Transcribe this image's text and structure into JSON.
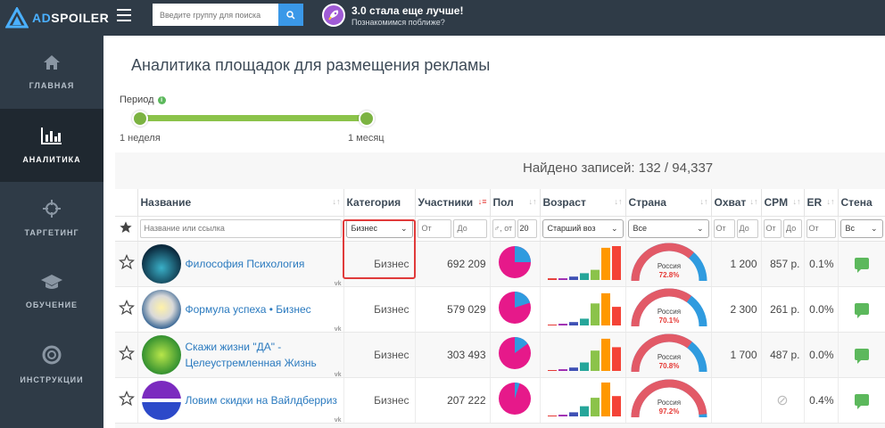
{
  "app": {
    "logo_ad": "AD",
    "logo_spoiler": "SPOILER"
  },
  "search": {
    "placeholder": "Введите группу для поиска"
  },
  "promo": {
    "title": "3.0 стала еще лучше!",
    "subtitle": "Познакомимся поближе?"
  },
  "sidebar": {
    "items": [
      {
        "label": "ГЛАВНАЯ",
        "icon": "home-icon"
      },
      {
        "label": "АНАЛИТИКА",
        "icon": "bar-chart-icon"
      },
      {
        "label": "ТАРГЕТИНГ",
        "icon": "target-icon"
      },
      {
        "label": "ОБУЧЕНИЕ",
        "icon": "graduation-cap-icon"
      },
      {
        "label": "ИНСТРУКЦИИ",
        "icon": "lifebuoy-icon"
      }
    ]
  },
  "page": {
    "title": "Аналитика площадок для размещения рекламы"
  },
  "period": {
    "label": "Период",
    "min_label": "1 неделя",
    "max_label": "1 месяц"
  },
  "results": {
    "label": "Найдено записей:",
    "count": "132 / 94,337"
  },
  "columns": {
    "name": "Название",
    "category": "Категория",
    "members": "Участники",
    "sex": "Пол",
    "age": "Возраст",
    "country": "Страна",
    "reach": "Охват",
    "cpm": "CPM",
    "er": "ER",
    "wall": "Стена"
  },
  "filters": {
    "name_placeholder": "Название или ссылка",
    "category": "Бизнес",
    "members_from": "От",
    "members_to": "До",
    "sex_prefix": "♂, от",
    "sex_value": "20",
    "age": "Старший воз",
    "country": "Все",
    "reach_from": "От",
    "reach_to": "До",
    "cpm_from": "От",
    "cpm_to": "До",
    "er_from": "От",
    "wall": "Вс"
  },
  "rows": [
    {
      "name": "Философия Психология",
      "category": "Бизнес",
      "members": "692 209",
      "country": "Россия",
      "country_pct": "72.8%",
      "reach": "1 200",
      "cpm": "857 р.",
      "er": "0.1%",
      "male_share": 0.25,
      "ages": [
        0.05,
        0.05,
        0.1,
        0.2,
        0.3,
        0.95,
        1.0
      ]
    },
    {
      "name": "Формула успеха • Бизнес",
      "category": "Бизнес",
      "members": "579 029",
      "country": "Россия",
      "country_pct": "70.1%",
      "reach": "2 300",
      "cpm": "261 р.",
      "er": "0.0%",
      "male_share": 0.2,
      "ages": [
        0,
        0.05,
        0.1,
        0.2,
        0.65,
        0.95,
        0.55
      ]
    },
    {
      "name": "Скажи жизни \"ДА\" - Целеустремленная Жизнь",
      "category": "Бизнес",
      "members": "303 493",
      "country": "Россия",
      "country_pct": "70.8%",
      "reach": "1 700",
      "cpm": "487 р.",
      "er": "0.0%",
      "male_share": 0.15,
      "ages": [
        0,
        0.05,
        0.1,
        0.25,
        0.6,
        0.95,
        0.7
      ]
    },
    {
      "name": "Ловим скидки на Вайлдберриз",
      "category": "Бизнес",
      "members": "207 222",
      "country": "Россия",
      "country_pct": "97.2%",
      "reach": "",
      "cpm": "",
      "er": "0.4%",
      "male_share": 0.05,
      "ages": [
        0,
        0.05,
        0.12,
        0.3,
        0.55,
        1.0,
        0.6
      ]
    }
  ],
  "colors": {
    "accent": "#3a98e8",
    "sidebar_bg": "#2f3b47",
    "slider": "#8bc34a",
    "highlight": "#e03a3a",
    "female": "#e6198a",
    "male": "#2f9bdf",
    "gauge": "#e25a67"
  }
}
